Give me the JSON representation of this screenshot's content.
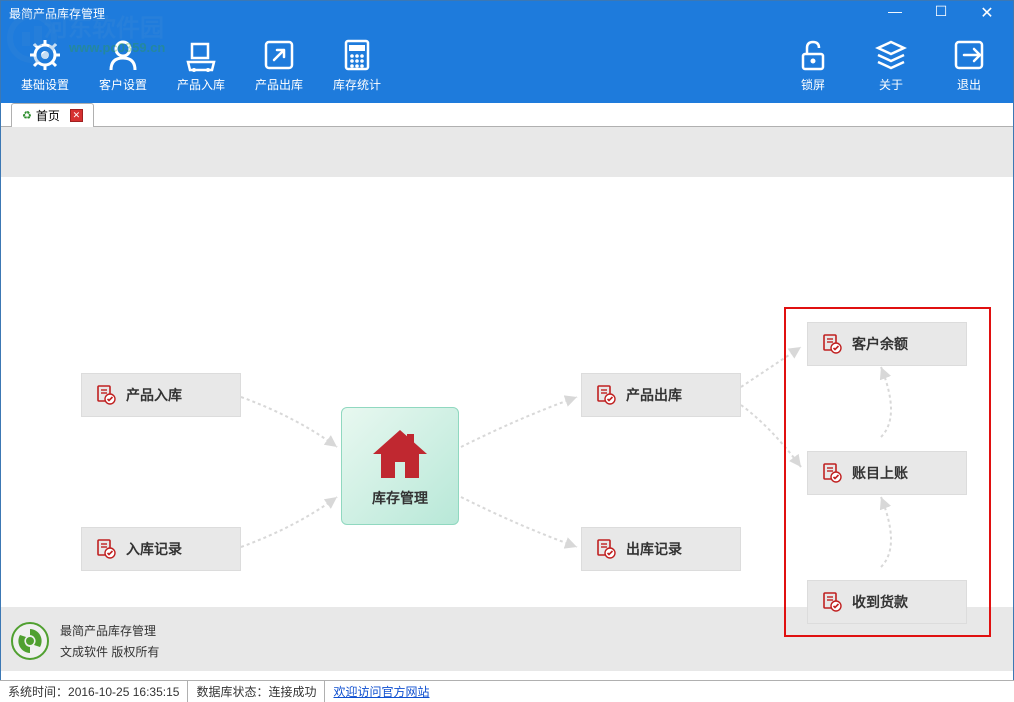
{
  "window": {
    "title": "最简产品库存管理"
  },
  "toolbar": {
    "left": [
      {
        "label": "基础设置",
        "icon": "gear"
      },
      {
        "label": "客户设置",
        "icon": "person"
      },
      {
        "label": "产品入库",
        "icon": "cart-in"
      },
      {
        "label": "产品出库",
        "icon": "arrow-out"
      },
      {
        "label": "库存统计",
        "icon": "calculator"
      }
    ],
    "right": [
      {
        "label": "锁屏",
        "icon": "lock"
      },
      {
        "label": "关于",
        "icon": "layers"
      },
      {
        "label": "退出",
        "icon": "exit"
      }
    ]
  },
  "tabs": {
    "home": {
      "label": "首页"
    }
  },
  "workflow": {
    "center": "库存管理",
    "product_in": "产品入库",
    "in_record": "入库记录",
    "product_out": "产品出库",
    "out_record": "出库记录",
    "customer_balance": "客户余额",
    "account_post": "账目上账",
    "payment_received": "收到货款"
  },
  "footer": {
    "line1": "最简产品库存管理",
    "line2": "文成软件 版权所有"
  },
  "statusbar": {
    "system_time_label": "系统时间：",
    "system_time": "2016-10-25 16:35:15",
    "db_status_label": "数据库状态：",
    "db_status": "连接成功",
    "link": "欢迎访问官方网站"
  },
  "watermark": {
    "line1": "河东软件园",
    "line2": "www.pc0359.cn"
  }
}
